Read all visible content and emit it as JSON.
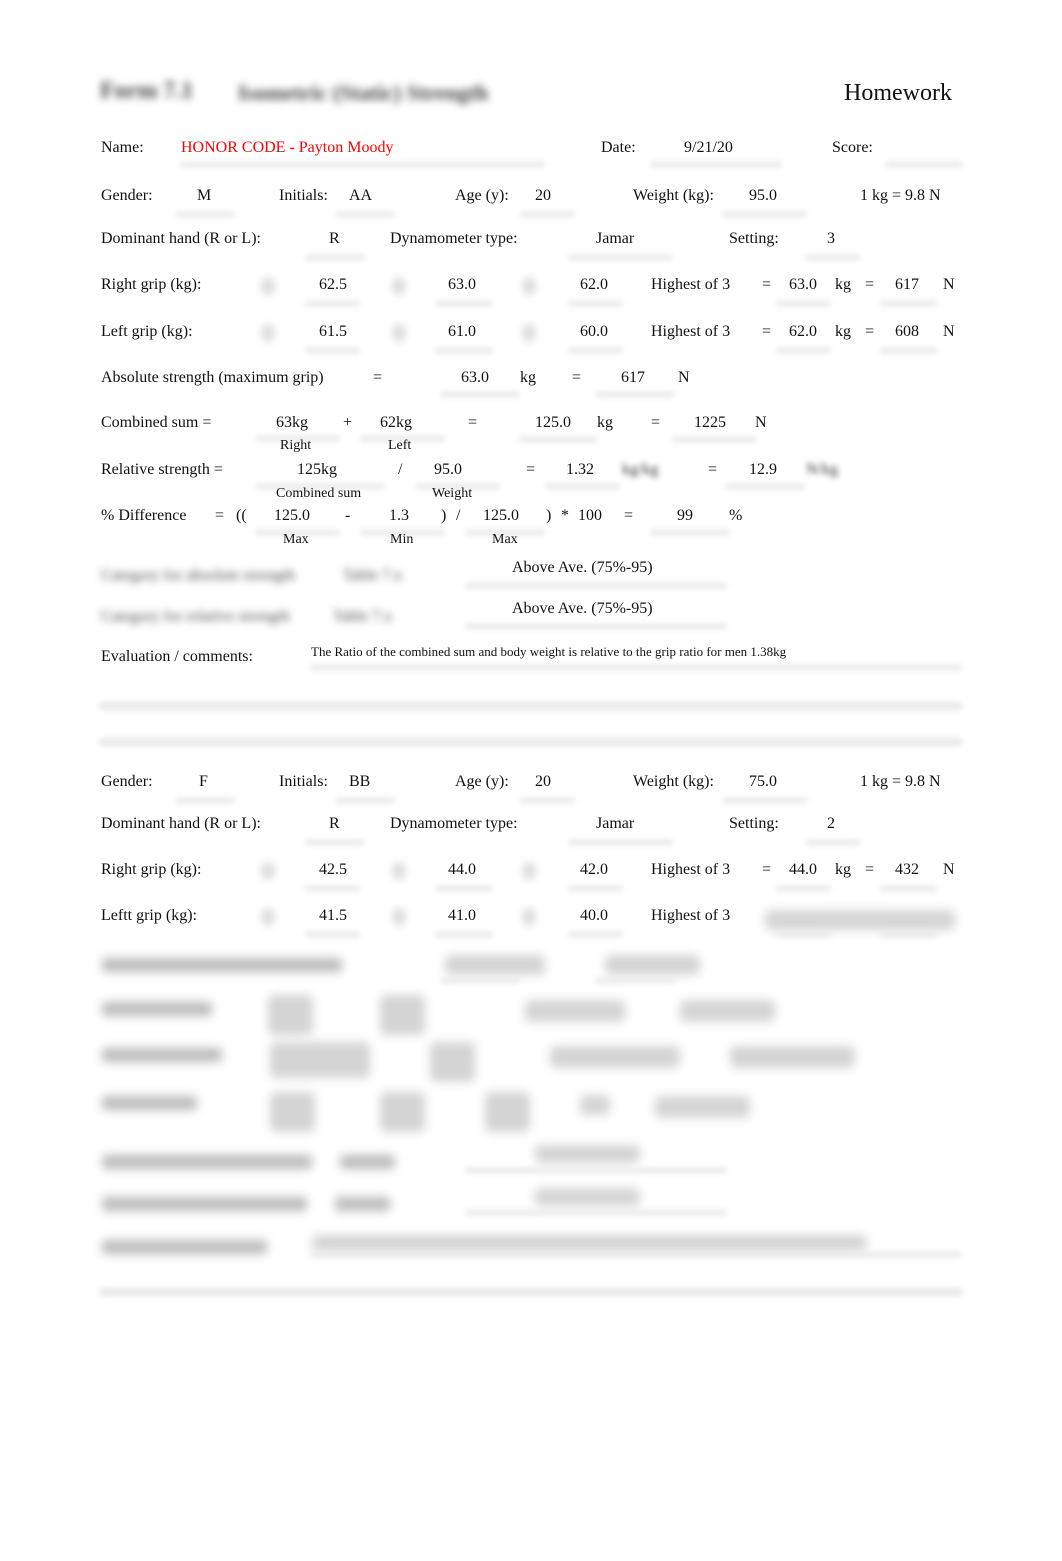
{
  "header": {
    "form_label": "Form 7.1",
    "form_title": "Isometric (Static) Strength",
    "homework_label": "Homework"
  },
  "meta": {
    "name_label": "Name:",
    "name_value": "HONOR CODE - Payton Moody",
    "date_label": "Date:",
    "date_value": "9/21/20",
    "score_label": "Score:",
    "score_value": ""
  },
  "labels": {
    "gender": "Gender:",
    "initials": "Initials:",
    "age": "Age (y):",
    "weight": "Weight (kg):",
    "conversion": "1 kg = 9.8 N",
    "dominant_hand": "Dominant hand (R or L):",
    "dynamometer_type": "Dynamometer type:",
    "setting": "Setting:",
    "right_grip": "Right grip (kg):",
    "left_grip": "Left grip (kg):",
    "left_grip_b": "Leftt grip (kg):",
    "highest_of_3": "Highest of 3",
    "equals": "=",
    "kg": "kg",
    "N": "N",
    "plus": "+",
    "slash": "/",
    "minus": "-",
    "open_paren": "((",
    "close_paren": ")",
    "times": "*",
    "hundred": "100",
    "percent": "%",
    "absolute_strength": "Absolute strength (maximum grip)",
    "combined_sum": "Combined sum =",
    "relative_strength": "Relative strength =",
    "pct_difference": "% Difference",
    "sub_right": "Right",
    "sub_left": "Left",
    "sub_combined": "Combined sum",
    "sub_weight": "Weight",
    "sub_max": "Max",
    "sub_min": "Min",
    "category_absolute": "Category for absolute strength",
    "category_relative": "Category for relative strength",
    "table_ref": "Table 7.x",
    "evaluation": "Evaluation / comments:"
  },
  "subject_a": {
    "gender": "M",
    "initials": "AA",
    "age": "20",
    "weight": "95.0",
    "dominant_hand": "R",
    "dynamometer": "Jamar",
    "setting": "3",
    "right_trials": [
      "62.5",
      "63.0",
      "62.0"
    ],
    "right_best_kg": "63.0",
    "right_best_n": "617",
    "left_trials": [
      "61.5",
      "61.0",
      "60.0"
    ],
    "left_best_kg": "62.0",
    "left_best_n": "608",
    "absolute_kg": "63.0",
    "absolute_n": "617",
    "combined_right": "63kg",
    "combined_left": "62kg",
    "combined_kg": "125.0",
    "combined_n": "1225",
    "relative_numerator": "125kg",
    "relative_weight": "95.0",
    "relative_value": "1.32",
    "relative_n": "12.9",
    "diff_max": "125.0",
    "diff_min": "1.3",
    "diff_max2": "125.0",
    "diff_result": "99",
    "category_absolute": "Above Ave. (75%-95)",
    "category_relative": "Above Ave. (75%-95)",
    "comment": "The Ratio of the combined sum and body weight is relative to the grip ratio for men 1.38kg"
  },
  "subject_b": {
    "gender": "F",
    "initials": "BB",
    "age": "20",
    "weight": "75.0",
    "dominant_hand": "R",
    "dynamometer": "Jamar",
    "setting": "2",
    "right_trials": [
      "42.5",
      "44.0",
      "42.0"
    ],
    "right_best_kg": "44.0",
    "right_best_n": "432",
    "left_trials": [
      "41.5",
      "41.0",
      "40.0"
    ]
  }
}
